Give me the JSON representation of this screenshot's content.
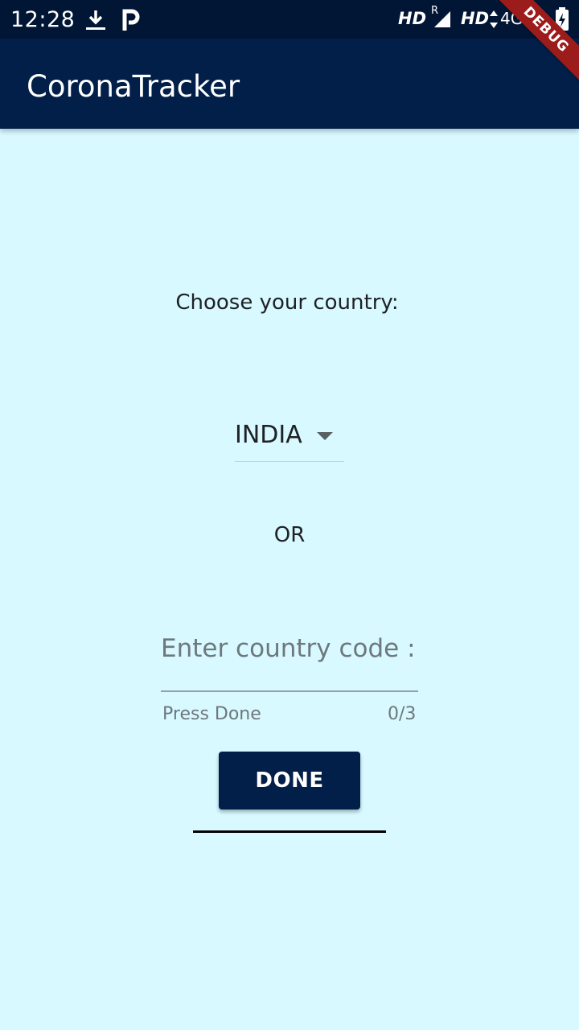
{
  "status_bar": {
    "time": "12:28",
    "hd_1": "HD",
    "roaming": "R",
    "hd_2": "HD",
    "network": "4G"
  },
  "app_bar": {
    "title": "CoronaTracker",
    "debug_banner": "DEBUG"
  },
  "main": {
    "choose_label": "Choose your country:",
    "dropdown_value": "INDIA",
    "or_label": "OR",
    "code_field": {
      "value": "",
      "placeholder": "Enter country code :",
      "helper": "Press Done",
      "counter": "0/3"
    },
    "done_label": "DONE"
  },
  "colors": {
    "background": "#d7f9ff",
    "app_bar": "#011f49",
    "status_bar": "#011635",
    "debug_banner": "#9c1b1b"
  }
}
